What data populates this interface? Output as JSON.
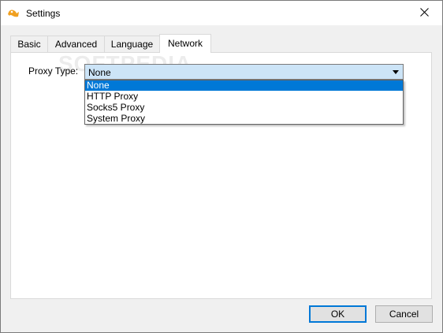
{
  "window": {
    "title": "Settings",
    "icon": "app-logo-icon",
    "close_icon": "close-icon"
  },
  "tabs": [
    {
      "label": "Basic",
      "active": false
    },
    {
      "label": "Advanced",
      "active": false
    },
    {
      "label": "Language",
      "active": false
    },
    {
      "label": "Network",
      "active": true
    }
  ],
  "network": {
    "proxy_type_label": "Proxy Type:",
    "proxy_type_value": "None",
    "proxy_options": [
      "None",
      "HTTP Proxy",
      "Socks5 Proxy",
      "System Proxy"
    ]
  },
  "watermark": "SOFTPEDIA",
  "buttons": {
    "ok": "OK",
    "cancel": "Cancel"
  },
  "colors": {
    "selection": "#0078d7",
    "combo_bg": "#cce4f7",
    "default_button_border": "#0078d7"
  }
}
